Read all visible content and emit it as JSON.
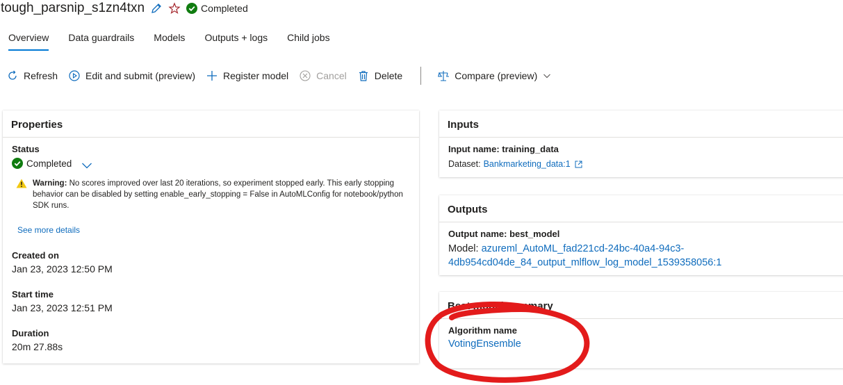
{
  "header": {
    "job_name": "tough_parsnip_s1zn4txn",
    "status": "Completed"
  },
  "tabs": [
    {
      "label": "Overview"
    },
    {
      "label": "Data guardrails"
    },
    {
      "label": "Models"
    },
    {
      "label": "Outputs + logs"
    },
    {
      "label": "Child jobs"
    }
  ],
  "toolbar": {
    "refresh": "Refresh",
    "edit_submit": "Edit and submit (preview)",
    "register_model": "Register model",
    "cancel": "Cancel",
    "delete": "Delete",
    "compare": "Compare (preview)"
  },
  "properties": {
    "title": "Properties",
    "status_label": "Status",
    "status_value": "Completed",
    "warning_prefix": "Warning:",
    "warning_text": "No scores improved over last 20 iterations, so experiment stopped early. This early stopping behavior can be disabled by setting enable_early_stopping = False in AutoMLConfig for notebook/python SDK runs.",
    "see_more": "See more details",
    "created_label": "Created on",
    "created_value": "Jan 23, 2023 12:50 PM",
    "start_label": "Start time",
    "start_value": "Jan 23, 2023 12:51 PM",
    "duration_label": "Duration",
    "duration_value": "20m 27.88s"
  },
  "inputs": {
    "title": "Inputs",
    "input_name": "Input name: training_data",
    "dataset_prefix": "Dataset:",
    "dataset_link": "Bankmarketing_data:1"
  },
  "outputs": {
    "title": "Outputs",
    "output_name": "Output name: best_model",
    "model_prefix": "Model:",
    "model_link_line1": "azureml_AutoML_fad221cd-24bc-40a4-94c3-",
    "model_link_line2": "4db954cd04de_84_output_mlflow_log_model_1539358056:1"
  },
  "best_model": {
    "title": "Best model summary",
    "algorithm_label": "Algorithm name",
    "algorithm_value": "VotingEnsemble"
  },
  "colors": {
    "accent": "#0078d4",
    "link": "#0f6cbd",
    "success": "#107c10",
    "warning": "#f2c811",
    "annotation": "#e31b1b"
  }
}
